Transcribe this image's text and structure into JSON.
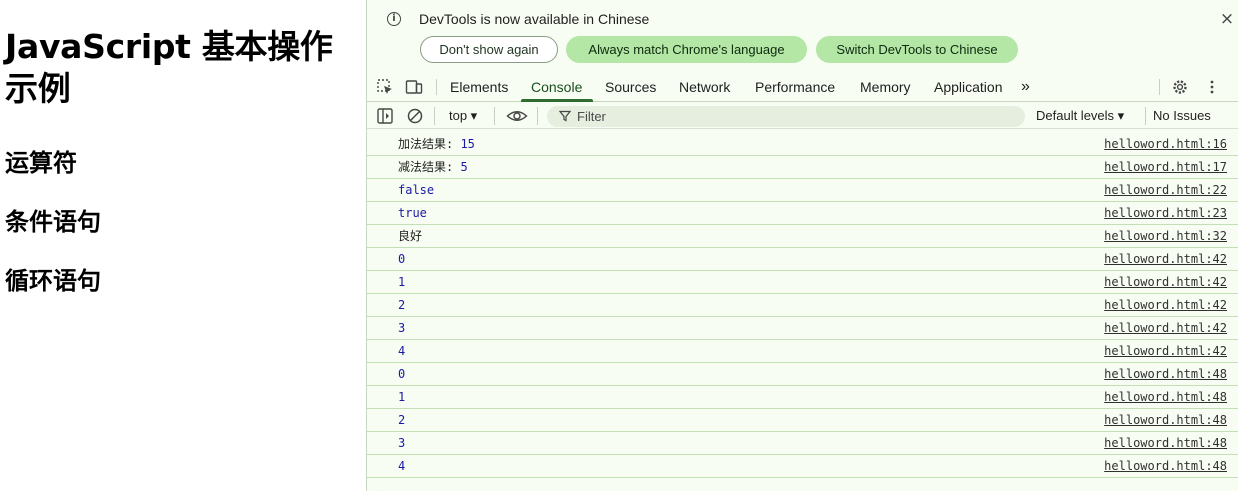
{
  "page": {
    "title": "JavaScript 基本操作示例",
    "headings": [
      "运算符",
      "条件语句",
      "循环语句"
    ]
  },
  "devtools": {
    "infobar": {
      "message": "DevTools is now available in Chinese",
      "buttons": [
        "Don't show again",
        "Always match Chrome's language",
        "Switch DevTools to Chinese"
      ],
      "close": "×"
    },
    "tabs": [
      "Elements",
      "Console",
      "Sources",
      "Network",
      "Performance",
      "Memory",
      "Application"
    ],
    "active_tab": "Console",
    "more_tabs": "»",
    "toolbar": {
      "context": "top ▾",
      "filter_placeholder": "Filter",
      "levels": "Default levels ▾",
      "issues": "No Issues"
    },
    "console_rows": [
      {
        "label": "加法结果: ",
        "value": "15",
        "source": "helloword.html:16"
      },
      {
        "label": "减法结果: ",
        "value": "5",
        "source": "helloword.html:17"
      },
      {
        "label": "",
        "value": "false",
        "source": "helloword.html:22"
      },
      {
        "label": "",
        "value": "true",
        "source": "helloword.html:23"
      },
      {
        "label": "良好",
        "value": "",
        "source": "helloword.html:32"
      },
      {
        "label": "",
        "value": "0",
        "source": "helloword.html:42"
      },
      {
        "label": "",
        "value": "1",
        "source": "helloword.html:42"
      },
      {
        "label": "",
        "value": "2",
        "source": "helloword.html:42"
      },
      {
        "label": "",
        "value": "3",
        "source": "helloword.html:42"
      },
      {
        "label": "",
        "value": "4",
        "source": "helloword.html:42"
      },
      {
        "label": "",
        "value": "0",
        "source": "helloword.html:48"
      },
      {
        "label": "",
        "value": "1",
        "source": "helloword.html:48"
      },
      {
        "label": "",
        "value": "2",
        "source": "helloword.html:48"
      },
      {
        "label": "",
        "value": "3",
        "source": "helloword.html:48"
      },
      {
        "label": "",
        "value": "4",
        "source": "helloword.html:48"
      }
    ],
    "prompt": "›"
  },
  "colors": {
    "devtools_bg": "#f8fdf3",
    "accent_green": "#b4e6a6",
    "value_blue": "#1a1aa6"
  }
}
